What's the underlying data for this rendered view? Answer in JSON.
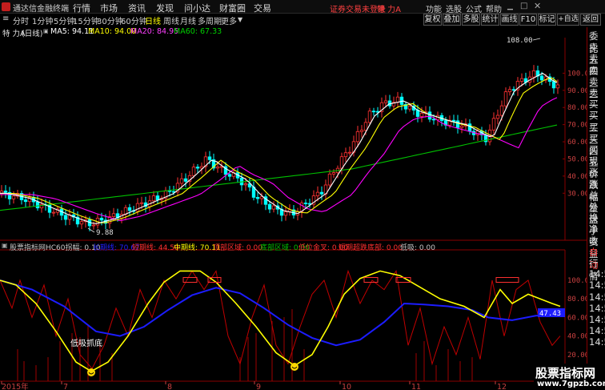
{
  "titlebar": {
    "app": "通达信金融终端",
    "menus": [
      "行情",
      "市场",
      "资讯",
      "发现",
      "问小达",
      "财富圈",
      "交易"
    ],
    "notice": "证券交易未登录",
    "stock": "特 力A",
    "right_menus": [
      "功能",
      "选股",
      "公式",
      "帮助"
    ]
  },
  "toolbar": {
    "periods": [
      "分时",
      "1分钟",
      "5分钟",
      "15分钟",
      "30分钟",
      "60分钟",
      "日线",
      "周线",
      "月线",
      "多周期",
      "更多"
    ],
    "active_period": "日线",
    "buttons": [
      "复权",
      "叠加",
      "多股",
      "统计",
      "画线",
      "F10",
      "标记",
      "+自选",
      "返回"
    ]
  },
  "infobar": {
    "name": "特 力A",
    "period": "(日线)",
    "ma5": "MA5: 94.11",
    "ma10": "MA10: 94.00",
    "ma20": "MA20: 84.95",
    "ma60": "MA60: 67.33"
  },
  "right_panel": [
    "委比",
    "卖五",
    "卖四",
    "卖三",
    "卖二",
    "卖一",
    "买一",
    "买二",
    "买三",
    "买四",
    "买五",
    "现价",
    "涨跌",
    "涨幅",
    "总量",
    "外盘",
    "换手",
    "净资",
    "收益",
    "自动",
    "行情",
    "14:5",
    "14:5",
    "14:5",
    "14:5",
    "14:5",
    "14:5",
    "14:5"
  ],
  "right_panel_colors": {
    "active": "#ff4040",
    "normal": "#dcdcdc"
  },
  "price_axis": [
    "100.00",
    "90.00",
    "80.00",
    "70.00",
    "60.00",
    "50.00",
    "40.00",
    "30.00"
  ],
  "max_label": "108.00",
  "min_label": "9.88",
  "ind_bar": {
    "title": "股票指标网",
    "name": "HC60拐幅: 0.10",
    "long": "长期线: 70.67",
    "short": "短期线: 44.50",
    "mid": "中期线: 70.11",
    "top": "顶部区域: 0.00",
    "bottom": "底部区域: 0.00",
    "low_gold": "低位金叉: 0.00",
    "super": "短期超跌底部: 0.00",
    "low_buy": "低吸: 0.00"
  },
  "ind_axis": [
    "100.0",
    "80.00",
    "60.00",
    "40.00",
    "20.00"
  ],
  "ind_value": "47.43",
  "annotation": "低吸抓底",
  "date_axis": [
    "2015年",
    "7",
    "8",
    "9",
    "10",
    "11",
    "12"
  ],
  "watermark": {
    "line1": "股票指标网",
    "line2": "www.7gpzb.com"
  },
  "chart_data": {
    "type": "line",
    "price_range": [
      0,
      120
    ],
    "price_series": [
      {
        "name": "MA5",
        "color": "#ffffff"
      },
      {
        "name": "MA10",
        "color": "#ffff00"
      },
      {
        "name": "MA20",
        "color": "#ff00ff"
      },
      {
        "name": "MA60",
        "color": "#00c000"
      }
    ],
    "max_point": 108.0,
    "min_point": 9.88,
    "indicator_range": [
      0,
      100
    ],
    "indicator_series": [
      {
        "name": "长期线",
        "color": "#2020ff",
        "last": 70.67
      },
      {
        "name": "短期线",
        "color": "#c00000",
        "last": 44.5
      },
      {
        "name": "中期线",
        "color": "#ffff00",
        "last": 70.11
      }
    ]
  }
}
